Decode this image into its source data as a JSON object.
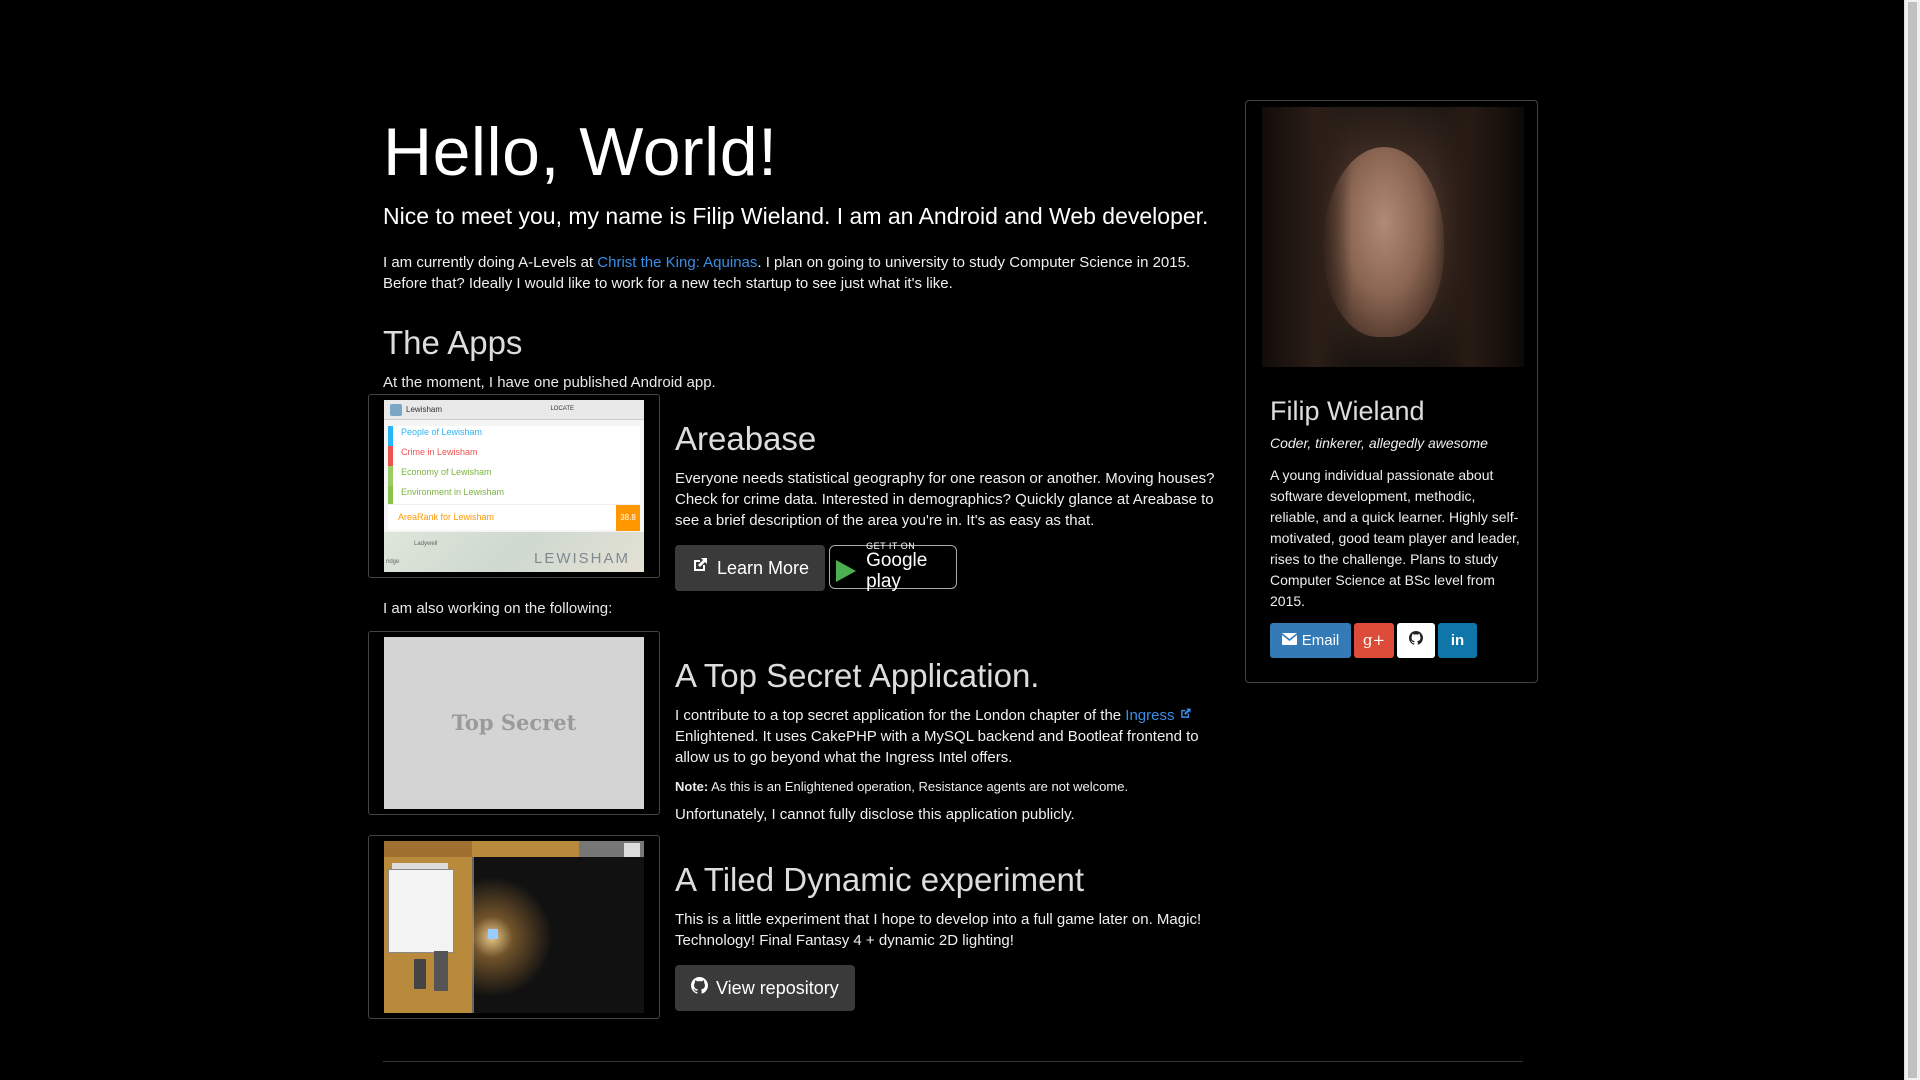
{
  "hero": {
    "title": "Hello, World!",
    "tagline": "Nice to meet you, my name is Filip Wieland. I am an Android and Web developer.",
    "intro_prefix": "I am currently doing A-Levels at ",
    "intro_link": "Christ the King: Aquinas",
    "intro_suffix": ". I plan on going to university to study Computer Science in 2015. Before that? Ideally I would like to work for a new tech startup to see just what it's like."
  },
  "apps_section": {
    "title": "The Apps",
    "lead": "At the moment, I have one published Android app.",
    "also_working": "I am also working on the following:"
  },
  "projects": {
    "areabase": {
      "title": "Areabase",
      "text": "Everyone needs statistical geography for one reason or another. Moving houses? Check for crime data. Interested in demographics? Quickly glance at Areabase to see a brief description of the area you're in. It's as easy as that.",
      "learn_more": "Learn More",
      "gplay_small": "GET IT ON",
      "gplay_big": "Google play",
      "thumb": {
        "header": "Lewisham",
        "locate": "LOCATE",
        "rows": [
          "People of Lewisham",
          "Crime in Lewisham",
          "Economy of Lewisham",
          "Environment in Lewisham"
        ],
        "arearank": "AreaRank for Lewisham",
        "score": "38.8",
        "map_label": "LEWISHAM",
        "map_small_1": "Ladywell",
        "map_small_2": "ridge"
      }
    },
    "secret": {
      "title": "A Top Secret Application.",
      "text_prefix": "I contribute to a top secret application for the London chapter of the ",
      "link": "Ingress",
      "text_suffix": " Enlightened. It uses CakePHP with a MySQL backend and Bootleaf frontend to allow us to go beyond what the Ingress Intel offers.",
      "note_label": "Note:",
      "note_text": " As this is an Enlightened operation, Resistance agents are not welcome.",
      "extra": "Unfortunately, I cannot fully disclose this application publicly.",
      "thumb_label": "Top Secret"
    },
    "tiled": {
      "title": "A Tiled Dynamic experiment",
      "text": "This is a little experiment that I hope to develop into a full game later on. Magic! Technology! Final Fantasy 4 + dynamic 2D lighting!",
      "repo": "View repository"
    }
  },
  "sidebar": {
    "name": "Filip Wieland",
    "subtitle": "Coder, tinkerer, allegedly awesome",
    "description": "A young individual passionate about software development, methodic, reliable, and a quick learner. Highly self-motivated, good team player and leader, rises to the challenge. Plans to study Computer Science at BSc level from 2015.",
    "socials": {
      "email": "Email",
      "gplus": "g+",
      "github_icon": "github-icon",
      "linkedin": "in"
    }
  },
  "colors": {
    "link": "#3a8ee6",
    "email": "#337ab7",
    "gplus": "#dd4b39",
    "github": "#ffffff",
    "linkedin": "#0e76a8",
    "button": "#3a3a3a"
  }
}
